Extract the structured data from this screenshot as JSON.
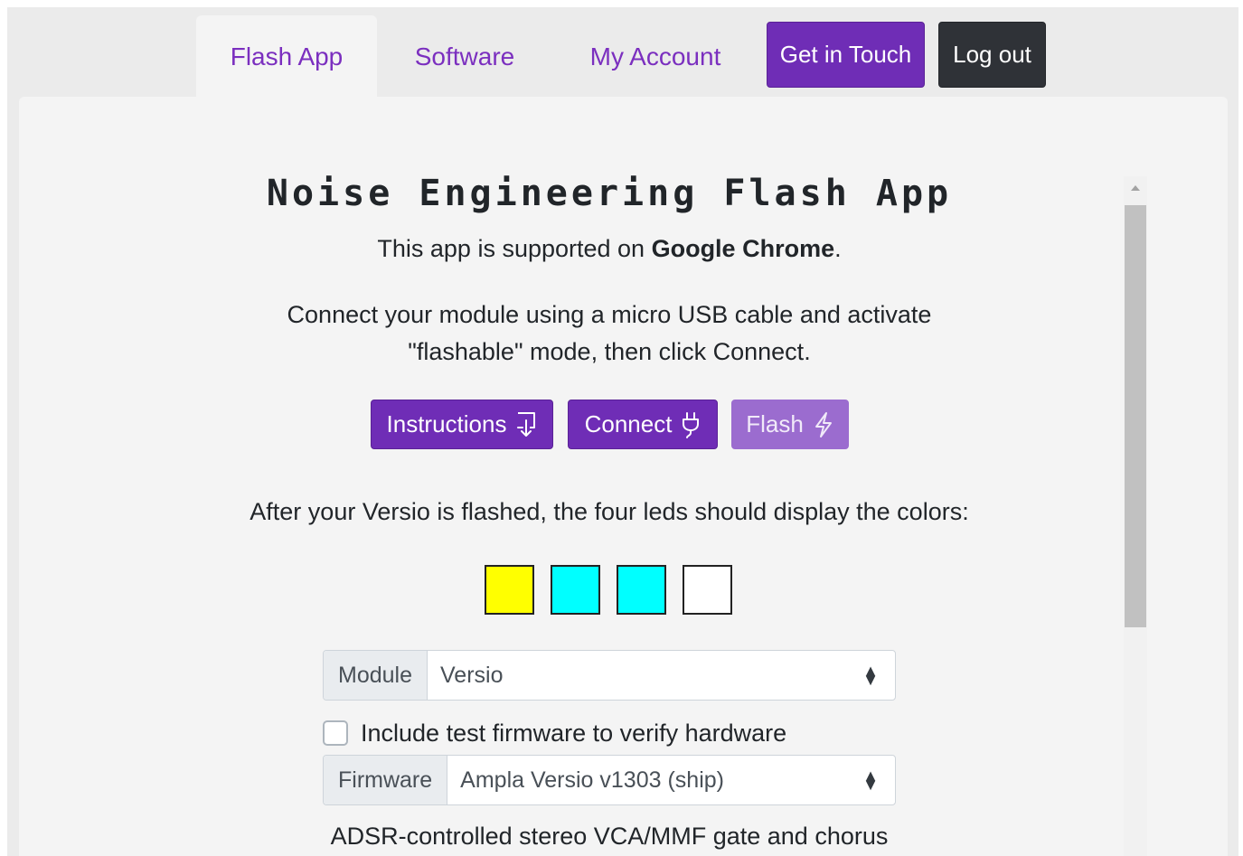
{
  "nav": {
    "tabs": [
      {
        "label": "Flash App",
        "active": true
      },
      {
        "label": "Software",
        "active": false
      },
      {
        "label": "My Account",
        "active": false
      }
    ],
    "get_in_touch": "Get in Touch",
    "log_out": "Log out"
  },
  "main": {
    "title": "Noise Engineering Flash App",
    "support_prefix": "This app is supported on ",
    "support_browser": "Google Chrome",
    "support_suffix": ".",
    "connect_line1": "Connect your module using a micro USB cable and activate",
    "connect_line2": "\"flashable\" mode, then click Connect.",
    "buttons": {
      "instructions": {
        "label": "Instructions",
        "icon": "download-icon"
      },
      "connect": {
        "label": "Connect",
        "icon": "plug-icon"
      },
      "flash": {
        "label": "Flash",
        "icon": "lightning-icon"
      }
    },
    "leds_text": "After your Versio is flashed, the four leds should display the colors:",
    "leds": [
      "#ffff00",
      "#00ffff",
      "#00ffff",
      "#ffffff"
    ],
    "module": {
      "label": "Module",
      "value": "Versio"
    },
    "test_firmware": {
      "label": "Include test firmware to verify hardware",
      "checked": false
    },
    "firmware": {
      "label": "Firmware",
      "value": "Ampla Versio v1303 (ship)"
    },
    "description": "ADSR-controlled stereo VCA/MMF gate and chorus"
  },
  "colors": {
    "accent": "#6f2db6",
    "accent_disabled": "#9b6ccf",
    "dark_button": "#2f3237",
    "tab_text": "#7b2fbf"
  }
}
